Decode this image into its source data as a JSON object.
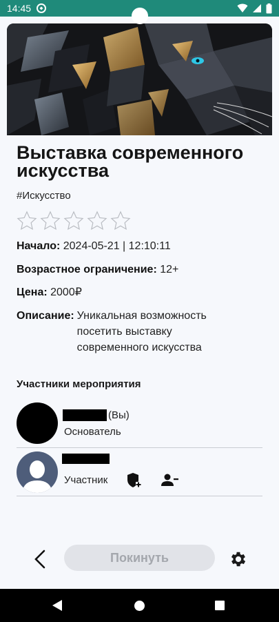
{
  "status_bar": {
    "time": "14:45"
  },
  "event": {
    "title": "Выставка современного искусства",
    "tag": "#Искусство",
    "rating_stars": 5,
    "rating_value": 0,
    "start_label": "Начало:",
    "start_value": "2024-05-21 | 12:10:11",
    "age_label": "Возрастное ограничение:",
    "age_value": "12+",
    "price_label": "Цена:",
    "price_value": "2000₽",
    "description_label": "Описание:",
    "description_value": "Уникальная возможность посетить выставку современного искусства"
  },
  "participants": {
    "section_title": "Участники мероприятия",
    "members": [
      {
        "you_label": "(Вы)",
        "role": "Основатель"
      },
      {
        "role": "Участник"
      }
    ]
  },
  "footer": {
    "leave_label": "Покинуть"
  },
  "colors": {
    "status_bar": "#1f8a7a",
    "button_bg": "#e1e3e8",
    "button_text": "#a4a7ad"
  }
}
